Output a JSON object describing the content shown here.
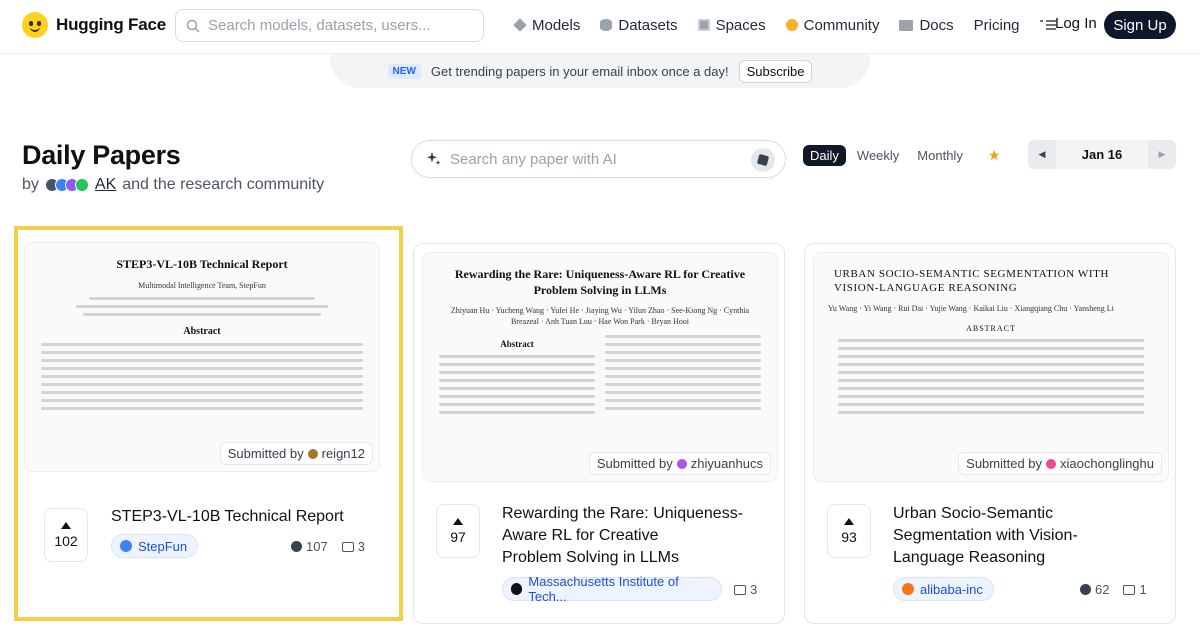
{
  "nav": {
    "brand": "Hugging Face",
    "search_placeholder": "Search models, datasets, users...",
    "links": [
      {
        "label": "Models",
        "icon": "models-icon"
      },
      {
        "label": "Datasets",
        "icon": "datasets-icon"
      },
      {
        "label": "Spaces",
        "icon": "spaces-icon"
      },
      {
        "label": "Community",
        "icon": "community-icon"
      },
      {
        "label": "Docs",
        "icon": "docs-icon"
      },
      {
        "label": "Pricing",
        "icon": ""
      }
    ],
    "login": "Log In",
    "signup": "Sign Up"
  },
  "banner": {
    "badge": "NEW",
    "text": "Get trending papers in your email inbox once a day!",
    "subscribe": "Subscribe"
  },
  "header": {
    "title": "Daily Papers",
    "by": "by",
    "author": "AK",
    "community": "and the research community",
    "search_placeholder": "Search any paper with AI",
    "tabs": [
      "Daily",
      "Weekly",
      "Monthly"
    ],
    "date": "Jan 16"
  },
  "papers": [
    {
      "title": "STEP3-VL-10B Technical Report",
      "upvotes": "102",
      "org": "StepFun",
      "github": "107",
      "comments": "3",
      "submitted_by": "reign12",
      "thumb": {
        "title": "STEP3-VL-10B Technical Report",
        "authors": "Multimodal Intelligence Team, StepFun",
        "abstract_heading": "Abstract"
      }
    },
    {
      "title": "Rewarding the Rare: Uniqueness-Aware RL for Creative Problem Solving in LLMs",
      "title_lines": [
        "Rewarding the Rare: Uniqueness-",
        "Aware RL for Creative",
        "Problem Solving in LLMs"
      ],
      "upvotes": "97",
      "org": "Massachusetts Institute of Tech...",
      "comments": "3",
      "submitted_by": "zhiyuanhucs",
      "thumb": {
        "title": "Rewarding the Rare: Uniqueness-Aware RL for Creative Problem Solving in LLMs",
        "authors": "Zhiyuan Hu · Yucheng Wang · Yufei He · Jiaying Wu · Yilun Zhao · See-Kiong Ng · Cynthia Breazeal · Anh Tuan Luu · Hae Won Park · Bryan Hooi",
        "abstract_heading": "Abstract"
      }
    },
    {
      "title": "Urban Socio-Semantic Segmentation with Vision-Language Reasoning",
      "title_lines": [
        "Urban Socio-Semantic",
        "Segmentation with Vision-",
        "Language Reasoning"
      ],
      "upvotes": "93",
      "org": "alibaba-inc",
      "github": "62",
      "comments": "1",
      "submitted_by": "xiaochonglinghu",
      "thumb": {
        "title": "URBAN SOCIO-SEMANTIC SEGMENTATION WITH VISION-LANGUAGE REASONING",
        "authors": "Yu Wang · Yi Wang · Rui Dai · Yujie Wang · Kaikai Liu · Xiangqiang Chu · Yansheng Li",
        "abstract_heading": "ABSTRACT"
      }
    }
  ],
  "submitted_prefix": "Submitted by",
  "colors": {
    "brand_yellow": "#ffd21e",
    "highlight_border": "#f5cf46",
    "signup_bg": "#0f172a",
    "org_pill_text": "#1d4ed8"
  }
}
